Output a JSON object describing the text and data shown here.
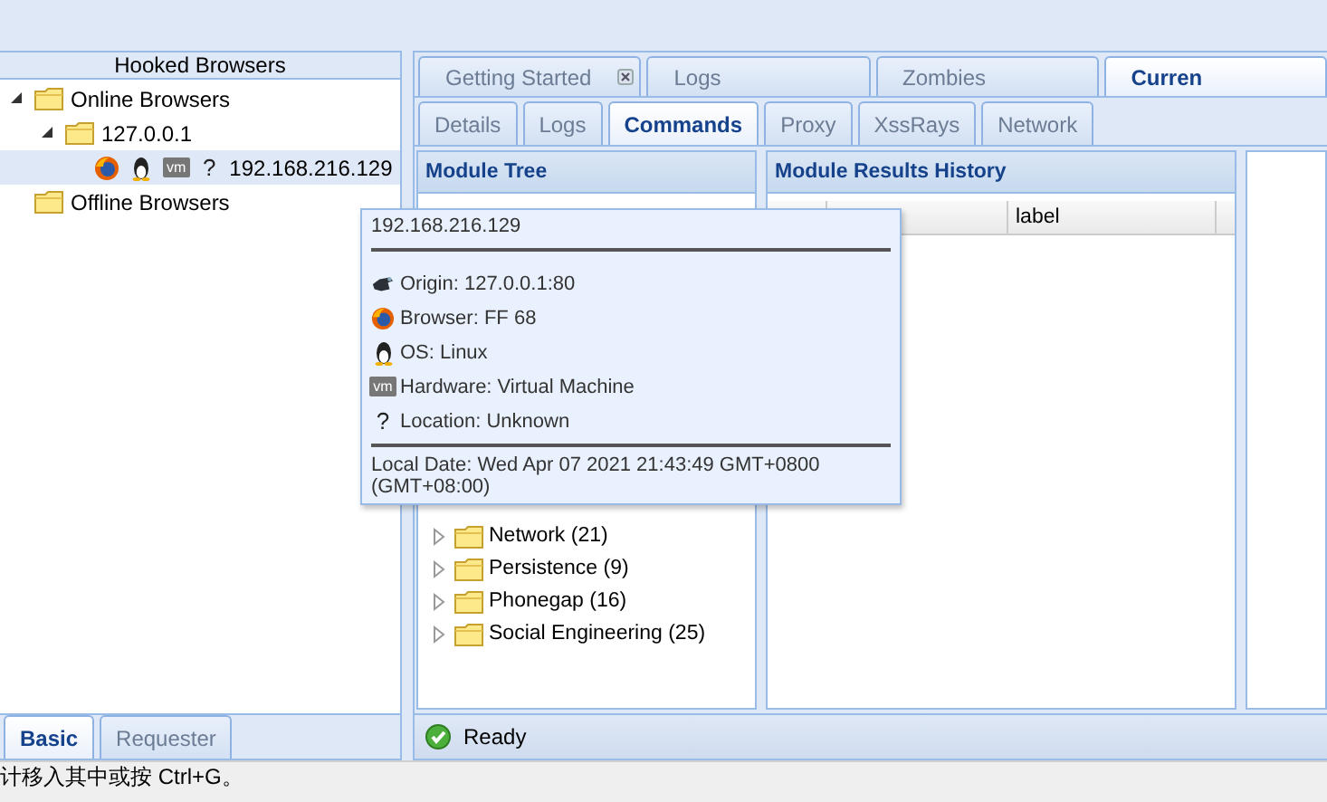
{
  "hooked_browsers": {
    "title": "Hooked Browsers",
    "tree": [
      {
        "label": "Online Browsers",
        "expanded": true,
        "children": [
          {
            "label": "127.0.0.1",
            "expanded": true,
            "children": [
              {
                "kind": "browser",
                "label": "192.168.216.129",
                "selected": true,
                "icons": [
                  {
                    "kind": "firefox"
                  },
                  {
                    "kind": "linux"
                  },
                  {
                    "kind": "vm",
                    "text": "vm"
                  },
                  {
                    "kind": "glyph",
                    "text": "?"
                  }
                ]
              }
            ]
          }
        ]
      },
      {
        "label": "Offline Browsers"
      }
    ]
  },
  "left_tabs": [
    {
      "label": "Basic",
      "selected": true
    },
    {
      "label": "Requester",
      "selected": false
    }
  ],
  "top_tabs": [
    {
      "label": "Getting Started",
      "selected": false,
      "closable": true
    },
    {
      "label": "Logs",
      "selected": false,
      "closable": false
    },
    {
      "label": "Zombies",
      "selected": false,
      "closable": false
    },
    {
      "label": "Curren",
      "selected": true,
      "closable": false
    }
  ],
  "sub_tabs": [
    {
      "label": "Details",
      "selected": false
    },
    {
      "label": "Logs",
      "selected": false
    },
    {
      "label": "Commands",
      "selected": true
    },
    {
      "label": "Proxy",
      "selected": false
    },
    {
      "label": "XssRays",
      "selected": false
    },
    {
      "label": "Network",
      "selected": false
    }
  ],
  "module_tree": {
    "title": "Module Tree",
    "items": [
      {
        "label": "Network (21)",
        "expanded": false
      },
      {
        "label": "Persistence (9)",
        "expanded": false
      },
      {
        "label": "Phonegap (16)",
        "expanded": false
      },
      {
        "label": "Social Engineering (25)",
        "expanded": false
      }
    ]
  },
  "results": {
    "title": "Module Results History",
    "columns": [
      "label"
    ]
  },
  "status_bar": {
    "ok": true,
    "text": "Ready"
  },
  "hint": "计移入其中或按 Ctrl+G。",
  "tooltip": {
    "title": "192.168.216.129",
    "lines": [
      {
        "icon": {
          "kind": "logo"
        },
        "text": "Origin: 127.0.0.1:80"
      },
      {
        "icon": {
          "kind": "firefox"
        },
        "text": "Browser: FF 68"
      },
      {
        "icon": {
          "kind": "linux"
        },
        "text": "OS: Linux"
      },
      {
        "icon": {
          "kind": "vm",
          "text": "vm"
        },
        "text": "Hardware: Virtual Machine"
      },
      {
        "icon": {
          "kind": "glyph",
          "text": "?"
        },
        "text": "Location: Unknown"
      }
    ],
    "footer": "Local Date: Wed Apr 07 2021 21:43:49 GMT+0800 (GMT+08:00)"
  }
}
